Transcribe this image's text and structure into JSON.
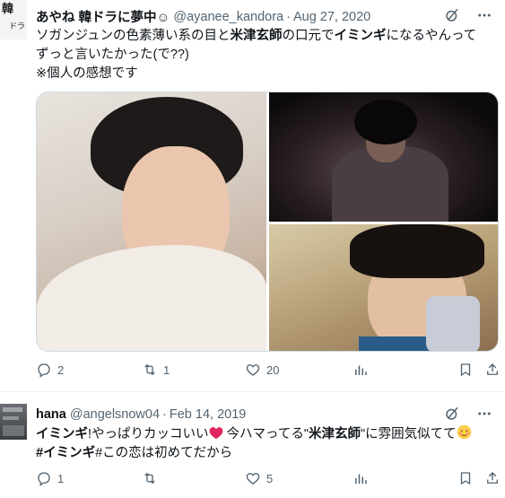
{
  "tweets": [
    {
      "name": "あやね 韓ドラに夢中☺",
      "handle": "@ayanee_kandora",
      "dot": "·",
      "date": "Aug 27, 2020",
      "avatar_text": "韓",
      "avatar_sub": "ドラ",
      "text_line1_a": "ソガンジュンの色素薄い系の目と",
      "text_line1_b": "米津玄師",
      "text_line1_c": "の口元で",
      "text_line1_d": "イミンギ",
      "text_line1_e": "になるやんって",
      "text_line2": "ずっと言いたかった(で??)",
      "text_line3": "※個人の感想です",
      "replies": "2",
      "retweets": "1",
      "likes": "20"
    },
    {
      "name": "hana",
      "handle": "@angelsnow04",
      "dot": "·",
      "date": "Feb 14, 2019",
      "text_line1_a": "イミンギ",
      "text_line1_b": "!やっぱりカッコいい",
      "text_line1_c": " 今ハマってる\"",
      "text_line1_d": "米津玄師",
      "text_line1_e": "\"に雰囲気似てて",
      "text_line2_a": "#イミンギ",
      "text_line2_b": "#この恋は初めてだから",
      "replies": "1",
      "retweets": "",
      "likes": "5"
    }
  ],
  "colors": {
    "text": "#0f1419",
    "muted": "#536471",
    "heart": "#e0245e"
  }
}
